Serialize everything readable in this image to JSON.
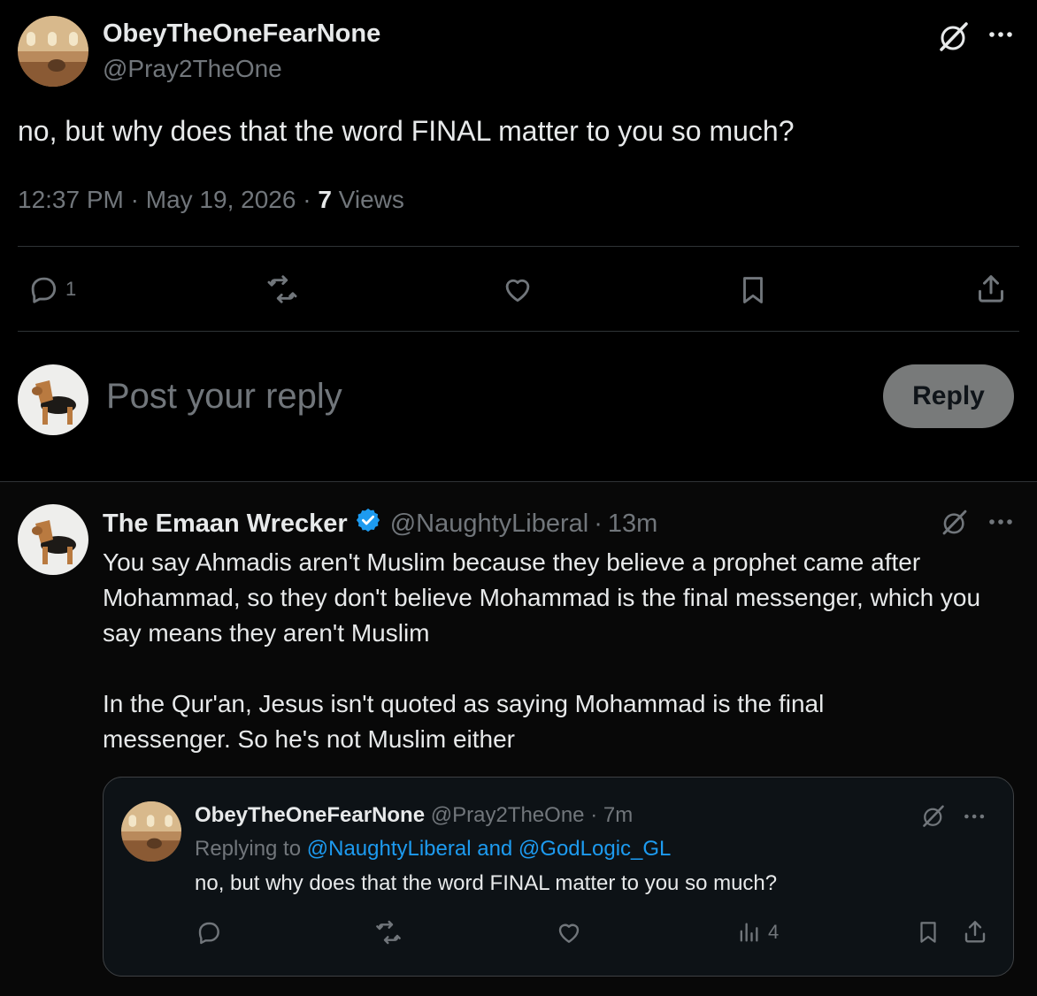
{
  "main_post": {
    "display_name": "ObeyTheOneFearNone",
    "handle": "@Pray2TheOne",
    "text": "no, but why does that the word FINAL matter to you so much?",
    "time": "12:37 PM",
    "date": "May 19, 2026",
    "sep": "·",
    "views_count": "7",
    "views_label": "Views",
    "actions": {
      "reply_count": "1"
    }
  },
  "composer": {
    "placeholder": "Post your reply",
    "button_label": "Reply"
  },
  "reply": {
    "display_name": "The Emaan Wrecker",
    "handle": "@NaughtyLiberal",
    "time_ago": "13m",
    "paragraph_1": "You say Ahmadis aren't Muslim because they believe a prophet came after Mohammad, so they don't believe Mohammad is the final messenger, which you say means they aren't Muslim",
    "paragraph_2": "In the Qur'an, Jesus isn't quoted as saying Mohammad is the final messenger. So he's not Muslim either",
    "quoted": {
      "display_name": "ObeyTheOneFearNone",
      "handle": "@Pray2TheOne",
      "time_ago": "7m",
      "replying_prefix": "Replying to",
      "replying_targets": "@NaughtyLiberal and @GodLogic_GL",
      "text": "no, but why does that the word FINAL matter to you so much?",
      "views_count": "4"
    }
  },
  "colors": {
    "background": "#000000",
    "text": "#e7e9ea",
    "muted": "#71767b",
    "link": "#1d9bf0",
    "verified": "#1d9bf0",
    "reply_button_bg": "#787a7a"
  },
  "icons": [
    "grok-icon",
    "more-icon",
    "reply-icon",
    "repost-icon",
    "like-icon",
    "bookmark-icon",
    "share-icon",
    "views-icon",
    "verified-badge-icon"
  ]
}
